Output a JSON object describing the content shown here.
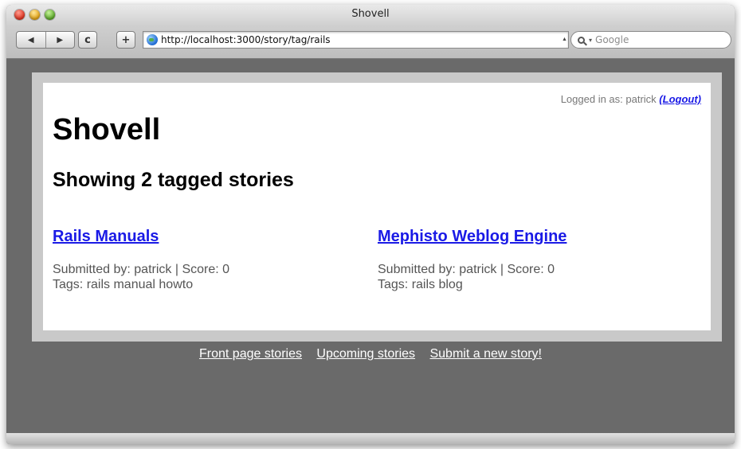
{
  "window": {
    "title": "Shovell"
  },
  "toolbar": {
    "back_icon": "◀",
    "forward_icon": "▶",
    "reload_icon": "c",
    "add_bookmark_icon": "+",
    "url": "http://localhost:3000/story/tag/rails",
    "search_placeholder": "Google"
  },
  "page": {
    "login_text": "Logged in as: patrick",
    "logout_label": "(Logout)",
    "site_title": "Shovell",
    "heading": "Showing 2 tagged stories",
    "stories": [
      {
        "title": "Rails Manuals",
        "submitted": "Submitted by: patrick | Score: 0",
        "tags": "Tags: rails manual howto"
      },
      {
        "title": "Mephisto Weblog Engine",
        "submitted": "Submitted by: patrick | Score: 0",
        "tags": "Tags: rails blog"
      }
    ],
    "footer_links": [
      "Front page stories",
      "Upcoming stories",
      "Submit a new story!"
    ]
  },
  "colors": {
    "link": "#1a1ae6",
    "page_bg": "#6a6a6a",
    "box_border": "#c9c9c9"
  }
}
